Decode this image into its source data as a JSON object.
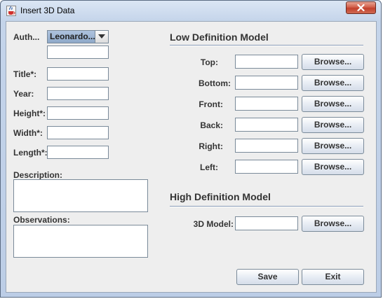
{
  "window": {
    "title": "Insert 3D Data",
    "icon": "java-cup-icon",
    "close_icon": "close-icon"
  },
  "left_form": {
    "author": {
      "label": "Auth...",
      "selected": "Leonardo...",
      "extra_value": ""
    },
    "fields": [
      {
        "label": "Title*:",
        "value": ""
      },
      {
        "label": "Year:",
        "value": ""
      },
      {
        "label": "Height*:",
        "value": ""
      },
      {
        "label": "Width*:",
        "value": ""
      },
      {
        "label": "Length*:",
        "value": ""
      }
    ],
    "description": {
      "label": "Description:",
      "value": ""
    },
    "observations": {
      "label": "Observations:",
      "value": ""
    }
  },
  "low_definition": {
    "title": "Low Definition Model",
    "rows": [
      {
        "label": "Top:",
        "value": "",
        "button": "Browse..."
      },
      {
        "label": "Bottom:",
        "value": "",
        "button": "Browse..."
      },
      {
        "label": "Front:",
        "value": "",
        "button": "Browse..."
      },
      {
        "label": "Back:",
        "value": "",
        "button": "Browse..."
      },
      {
        "label": "Right:",
        "value": "",
        "button": "Browse..."
      },
      {
        "label": "Left:",
        "value": "",
        "button": "Browse..."
      }
    ]
  },
  "high_definition": {
    "title": "High Definition Model",
    "row": {
      "label": "3D Model:",
      "value": "",
      "button": "Browse..."
    }
  },
  "footer": {
    "save_label": "Save",
    "exit_label": "Exit"
  },
  "colors": {
    "window_frame": "#c4d4ea",
    "client_bg": "#eeeeee",
    "close_button": "#c2402c",
    "combo_selection": "#8ea8c8"
  }
}
